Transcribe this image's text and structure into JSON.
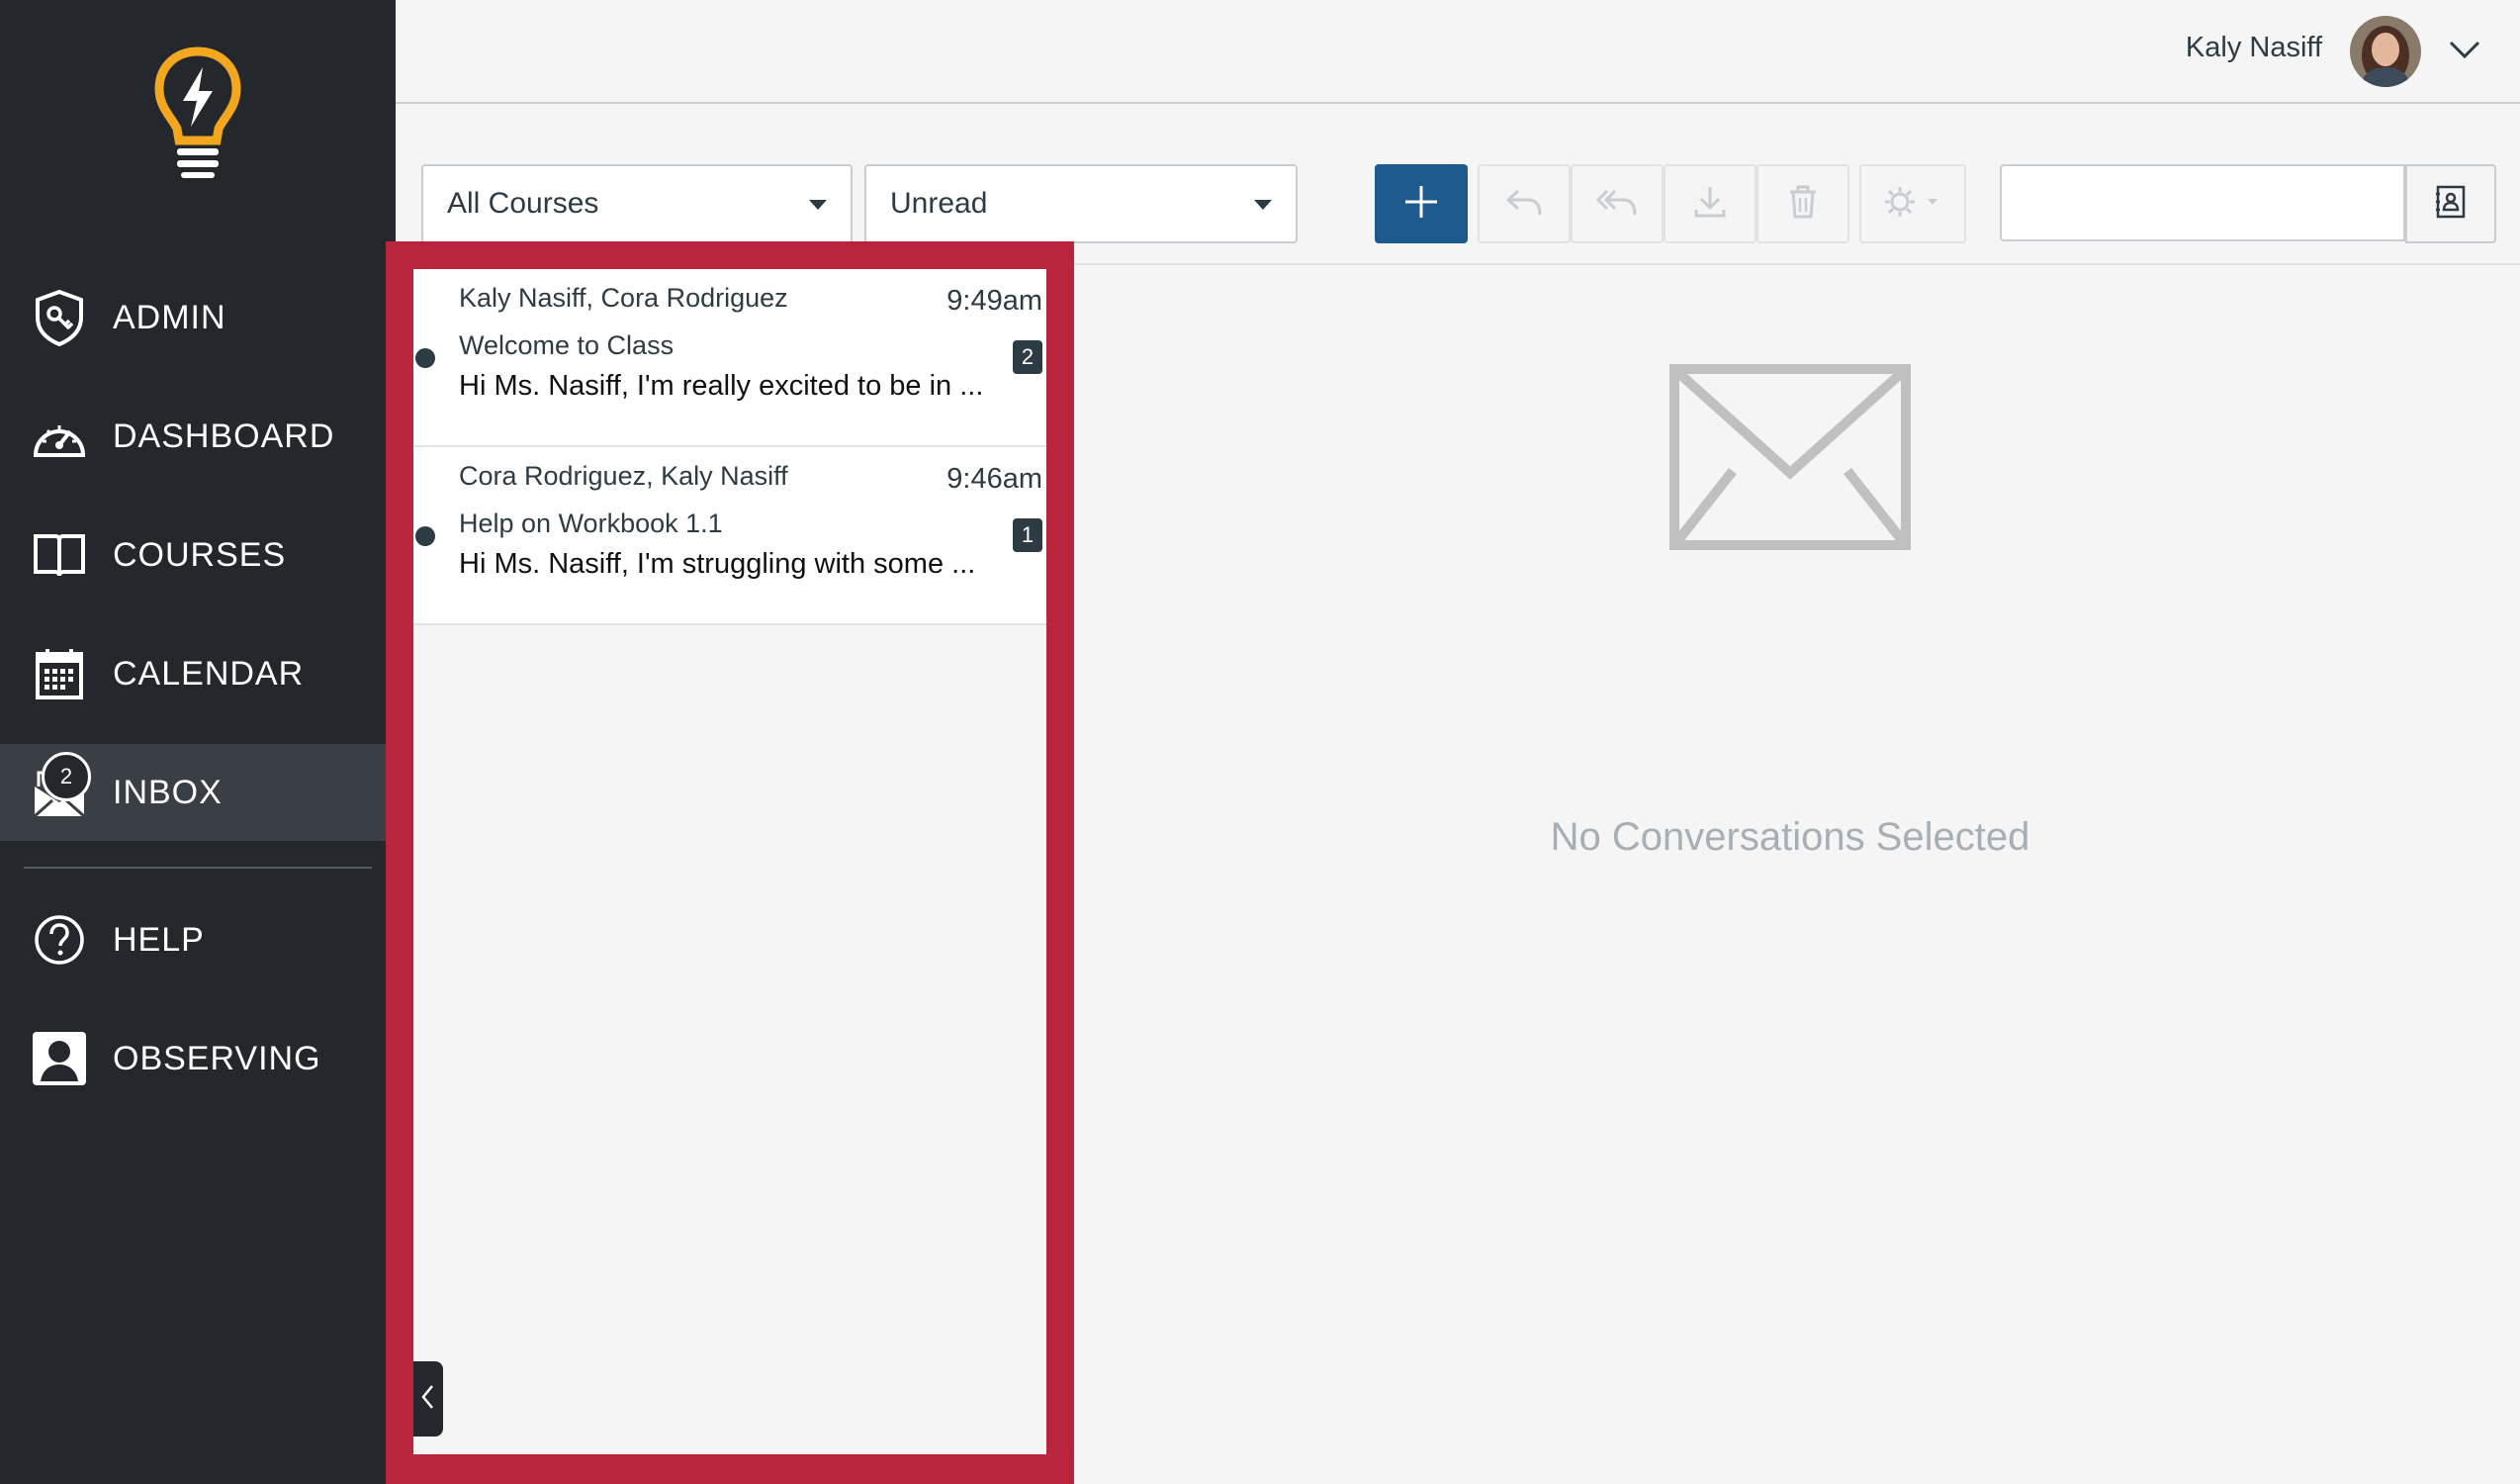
{
  "sidebar": {
    "items": [
      {
        "label": "ADMIN",
        "icon": "admin-shield-icon"
      },
      {
        "label": "DASHBOARD",
        "icon": "dashboard-gauge-icon"
      },
      {
        "label": "COURSES",
        "icon": "book-icon"
      },
      {
        "label": "CALENDAR",
        "icon": "calendar-icon"
      },
      {
        "label": "INBOX",
        "icon": "inbox-icon",
        "badge": "2",
        "active": true
      },
      {
        "label": "HELP",
        "icon": "help-icon"
      },
      {
        "label": "OBSERVING",
        "icon": "observer-icon"
      }
    ]
  },
  "header": {
    "user_name": "Kaly Nasiff"
  },
  "toolbar": {
    "course_filter": "All Courses",
    "type_filter": "Unread",
    "search_placeholder": ""
  },
  "conversations": [
    {
      "participants": "Kaly Nasiff, Cora Rodriguez",
      "time": "9:49am",
      "subject": "Welcome to Class",
      "preview": "Hi Ms. Nasiff, I'm really excited to be in ...",
      "count": "2",
      "unread": true
    },
    {
      "participants": "Cora Rodriguez, Kaly Nasiff",
      "time": "9:46am",
      "subject": "Help on Workbook 1.1",
      "preview": "Hi Ms. Nasiff, I'm struggling with some ...",
      "count": "1",
      "unread": true
    }
  ],
  "main": {
    "empty_text": "No Conversations Selected"
  },
  "colors": {
    "sidebar_bg": "#24272c",
    "primary": "#1d5a8e",
    "highlight_frame": "#b8253d",
    "logo": "#f2a71e"
  }
}
